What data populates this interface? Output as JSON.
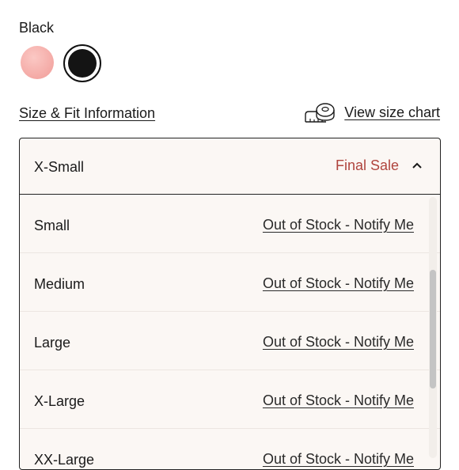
{
  "color": {
    "selected_name": "Black",
    "swatches": [
      {
        "name": "pink",
        "hex": "#f4a9a5",
        "selected": false
      },
      {
        "name": "black",
        "hex": "#141414",
        "selected": true
      }
    ]
  },
  "links": {
    "size_fit": "Size & Fit Information",
    "size_chart": "View size chart"
  },
  "size_select": {
    "selected": "X-Small",
    "selected_note": "Final Sale",
    "expanded": true,
    "options": [
      {
        "label": "Small",
        "status": "Out of Stock - Notify Me"
      },
      {
        "label": "Medium",
        "status": "Out of Stock - Notify Me"
      },
      {
        "label": "Large",
        "status": "Out of Stock - Notify Me"
      },
      {
        "label": "X-Large",
        "status": "Out of Stock - Notify Me"
      },
      {
        "label": "XX-Large",
        "status": "Out of Stock - Notify Me"
      }
    ]
  },
  "colors": {
    "final_sale": "#b0453e",
    "dropdown_bg": "#fbf7f4",
    "border": "#222222"
  }
}
